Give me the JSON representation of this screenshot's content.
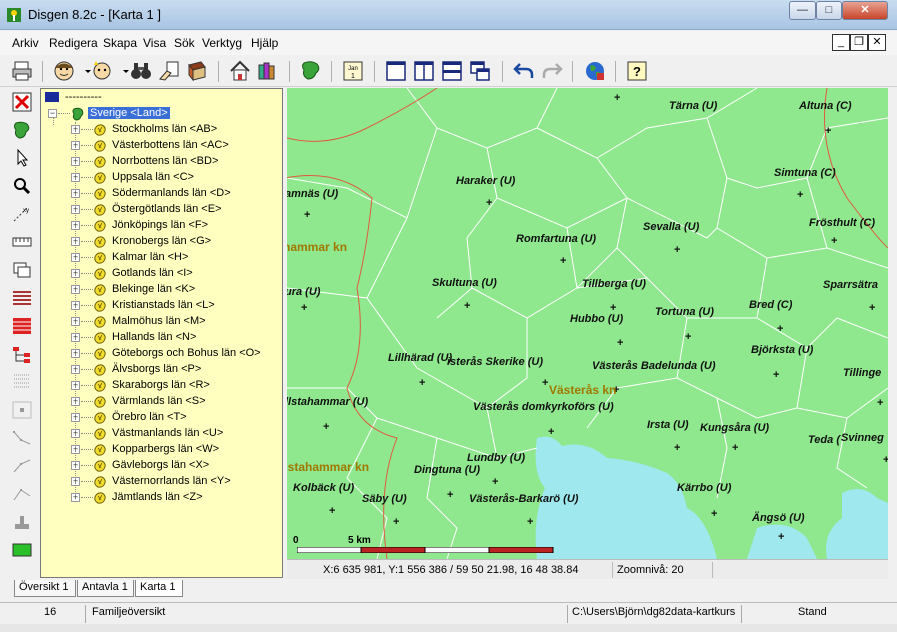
{
  "window": {
    "title": "Disgen 8.2c - [Karta 1 ]",
    "minimize": "—",
    "maximize": "□",
    "close": "✕"
  },
  "menu": {
    "items": [
      "Arkiv",
      "Redigera",
      "Skapa",
      "Visa",
      "Sök",
      "Verktyg",
      "Hjälp"
    ],
    "mdi_minimize": "_",
    "mdi_restore": "❐",
    "mdi_close": "✕"
  },
  "toolbar": {
    "calendar_text": "Jan\n1"
  },
  "tree": {
    "root_label": "----------",
    "country_label": "Sverige <Land>",
    "counties": [
      "Stockholms län <AB>",
      "Västerbottens län <AC>",
      "Norrbottens län <BD>",
      "Uppsala län <C>",
      "Södermanlands län <D>",
      "Östergötlands län <E>",
      "Jönköpings län <F>",
      "Kronobergs län <G>",
      "Kalmar län <H>",
      "Gotlands län <I>",
      "Blekinge län <K>",
      "Kristianstads län <L>",
      "Malmöhus län <M>",
      "Hallands län <N>",
      "Göteborgs och Bohus län <O>",
      "Älvsborgs län <P>",
      "Skaraborgs län <R>",
      "Värmlands län <S>",
      "Örebro län <T>",
      "Västmanlands län <U>",
      "Kopparbergs län <W>",
      "Gävleborgs län <X>",
      "Västernorrlands län <Y>",
      "Jämtlands län <Z>"
    ]
  },
  "map": {
    "places": [
      "Tärna (U)",
      "Altuna (C)",
      "amnäs (U)",
      "Haraker (U)",
      "Simtuna (C)",
      "Sevalla (U)",
      "Frösthult (C)",
      "Romfartuna (U)",
      "ura (U)",
      "Skultuna (U)",
      "Tillberga (U)",
      "Sparrsätra",
      "Tortuna (U)",
      "Bred (C)",
      "Hubbo (U)",
      "Björksta (U)",
      "Lillhärad (U)",
      "isterås Skerike (U)",
      "Västerås Badelunda (U)",
      "Tillinge",
      "llstahammar (U)",
      "Västerås domkyrkoförs (U)",
      "Irsta (U)",
      "Kungsåra (U)",
      "Teda (",
      "Svinneg",
      "Lundby (U)",
      "Dingtuna (U)",
      "Kolbäck (U)",
      "Säby (U)",
      "Västerås-Barkarö (U)",
      "Kärrbo (U)",
      "Ängsö (U)"
    ],
    "municipalities": [
      "hammar kn",
      "Västerås kn",
      "llstahammar kn"
    ],
    "scale_start": "0",
    "scale_label": "5 km"
  },
  "map_status": {
    "coordinates": "X:6 635 981, Y:1 556 386 / 59 50 21.98, 16 48 38.84",
    "zoom": "Zoomnivå: 20"
  },
  "tabs": [
    "Översikt 1",
    "Antavla 1",
    "Karta 1"
  ],
  "status": {
    "count": "16",
    "view": "Familjeöversikt",
    "path": "C:\\Users\\Björn\\dg82data-kartkurs",
    "mode": "Stand"
  }
}
